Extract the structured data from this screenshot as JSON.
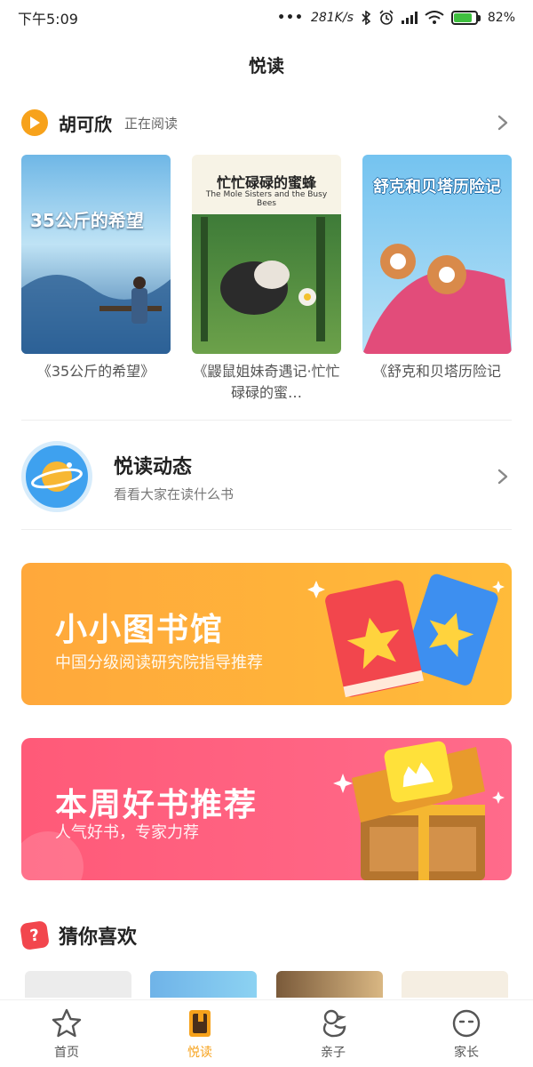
{
  "status_bar": {
    "time": "下午5:09",
    "dots": "•••",
    "speed": "281K/s",
    "battery": "82%",
    "battery_level": 0.82
  },
  "page": {
    "title": "悦读"
  },
  "reading": {
    "name": "胡可欣",
    "status": "正在阅读",
    "books": [
      {
        "title": "《35公斤的希望》",
        "cover_text": "35公斤的希望"
      },
      {
        "title": "《鼹鼠姐妹奇遇记·忙忙碌碌的蜜…",
        "cover_text": "忙忙碌碌的蜜蜂",
        "cover_en": "The Mole Sisters and the Busy Bees"
      },
      {
        "title": "《舒克和贝塔历险记",
        "cover_text": "舒克和贝塔历险记"
      }
    ]
  },
  "dynamic": {
    "title": "悦读动态",
    "subtitle": "看看大家在读什么书"
  },
  "banners": [
    {
      "title": "小小图书馆",
      "subtitle": "中国分级阅读研究院指导推荐",
      "color": "#ffa83b"
    },
    {
      "title": "本周好书推荐",
      "subtitle": "人气好书，专家力荐",
      "color": "#ff5a78"
    }
  ],
  "guess": {
    "title": "猜你喜欢",
    "icon": "?"
  },
  "nav": {
    "items": [
      {
        "label": "首页",
        "icon": "star-icon"
      },
      {
        "label": "悦读",
        "icon": "book-icon"
      },
      {
        "label": "亲子",
        "icon": "duck-icon"
      },
      {
        "label": "家长",
        "icon": "face-icon"
      }
    ],
    "active_color": "#f7a21b"
  }
}
